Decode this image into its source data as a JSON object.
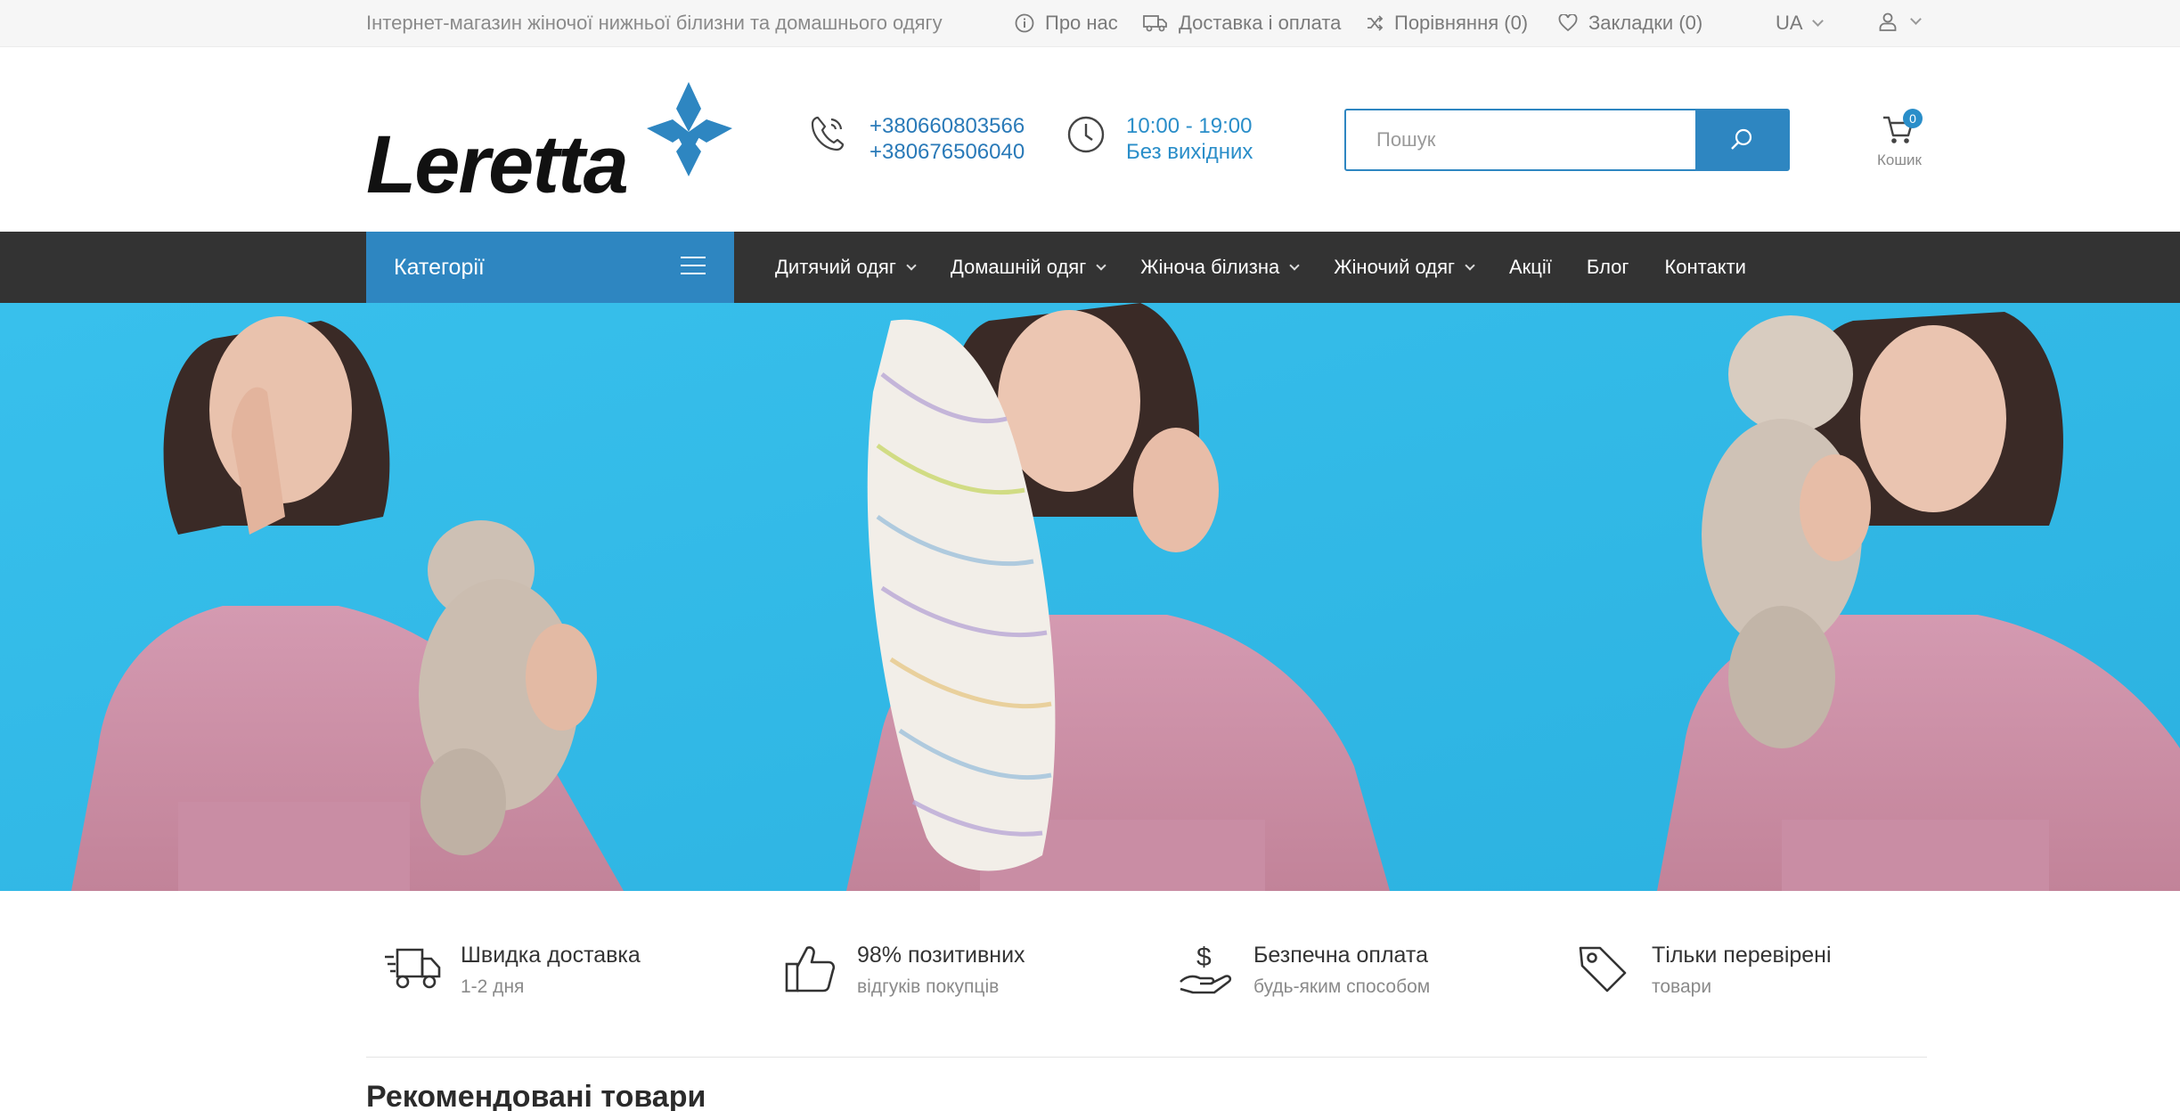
{
  "topbar": {
    "tagline": "Інтернет-магазин жіночої нижньої білизни та домашнього одягу",
    "about": "Про нас",
    "delivery": "Доставка і оплата",
    "compare": "Порівняння (0)",
    "bookmarks": "Закладки (0)",
    "language": "UA"
  },
  "header": {
    "logo_text": "Leretta",
    "phones": [
      "+380660803566",
      "+380676506040"
    ],
    "hours": "10:00 - 19:00",
    "days_off": "Без вихідних",
    "search_placeholder": "Пошук",
    "cart_count": "0",
    "cart_label": "Кошик"
  },
  "nav": {
    "categories_label": "Категорії",
    "items": [
      {
        "label": "Дитячий одяг",
        "dropdown": true
      },
      {
        "label": "Домашній одяг",
        "dropdown": true
      },
      {
        "label": "Жіноча білизна",
        "dropdown": true
      },
      {
        "label": "Жіночий одяг",
        "dropdown": true
      },
      {
        "label": "Акції",
        "dropdown": false
      },
      {
        "label": "Блог",
        "dropdown": false
      },
      {
        "label": "Контакти",
        "dropdown": false
      }
    ]
  },
  "features": [
    {
      "icon": "truck-icon",
      "title": "Швидка доставка",
      "subtitle": "1-2 дня"
    },
    {
      "icon": "thumbs-up-icon",
      "title": "98% позитивних",
      "subtitle": "відгуків покупців"
    },
    {
      "icon": "money-hand-icon",
      "title": "Безпечна оплата",
      "subtitle": "будь-яким способом"
    },
    {
      "icon": "tag-icon",
      "title": "Тільки перевірені",
      "subtitle": "товари"
    }
  ],
  "sections": {
    "recommended_title": "Рекомендовані товари"
  },
  "colors": {
    "accent": "#2e86c1",
    "nav_bg": "#333333",
    "banner_bg": "#32bae8",
    "hoodie": "#cf92aa"
  }
}
